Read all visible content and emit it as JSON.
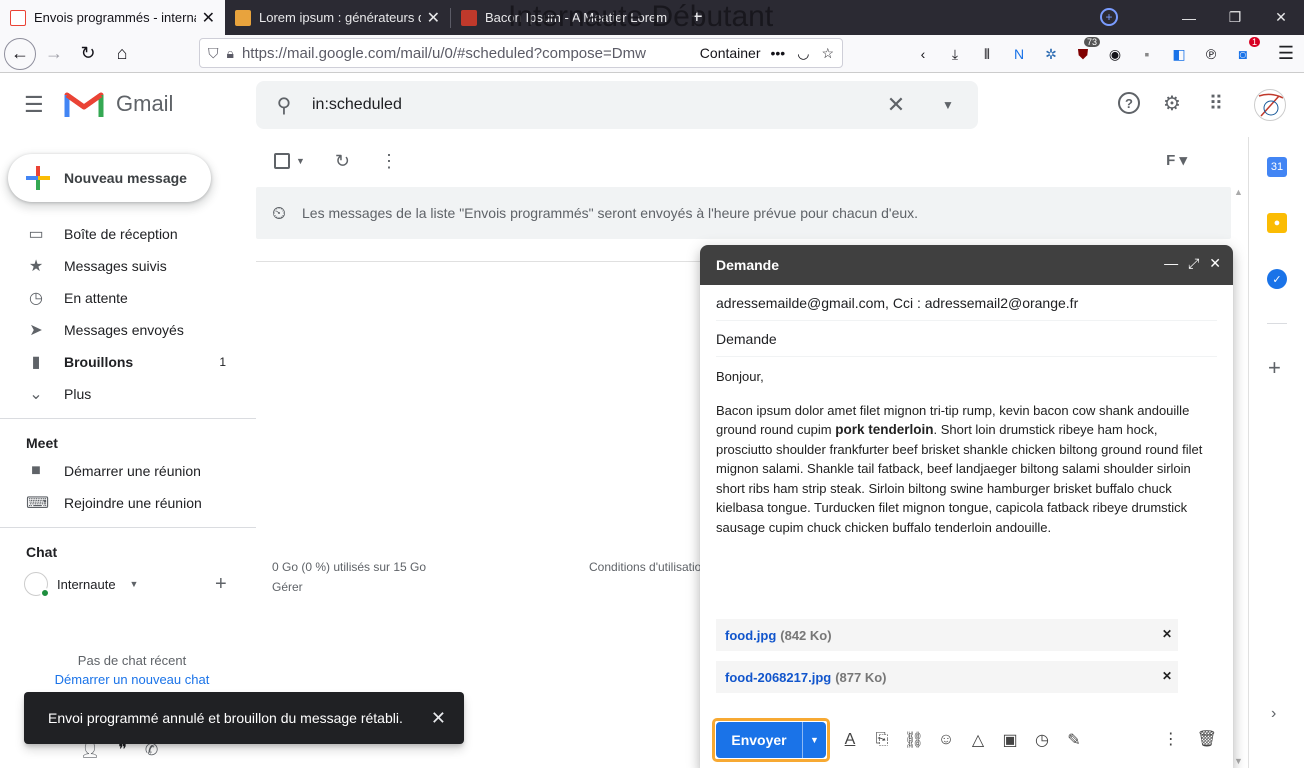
{
  "browser": {
    "tabs": [
      {
        "title": "Envois programmés - internaute",
        "active": true
      },
      {
        "title": "Lorem ipsum : générateurs de f",
        "active": false
      },
      {
        "title": "Bacon Ipsum - A Meatier Lorem",
        "active": false
      }
    ],
    "overlay_title": "Internaute Débutant",
    "url": "https://mail.google.com/mail/u/0/#scheduled?compose=Dmw",
    "url_domain": "mail.google.com",
    "container_label": "Container",
    "ext_badges": {
      "ublock": "73",
      "notif": "1"
    }
  },
  "gmail": {
    "app_name": "Gmail",
    "search_value": "in:scheduled",
    "compose_label": "Nouveau message",
    "nav": [
      {
        "icon": "inbox-icon",
        "glyph": "▭",
        "label": "Boîte de réception",
        "count": ""
      },
      {
        "icon": "star-icon",
        "glyph": "★",
        "label": "Messages suivis",
        "count": ""
      },
      {
        "icon": "clock-icon",
        "glyph": "◷",
        "label": "En attente",
        "count": ""
      },
      {
        "icon": "send-icon",
        "glyph": "➤",
        "label": "Messages envoyés",
        "count": ""
      },
      {
        "icon": "draft-icon",
        "glyph": "▮",
        "label": "Brouillons",
        "count": "1"
      },
      {
        "icon": "chevron-down-icon",
        "glyph": "⌄",
        "label": "Plus",
        "count": ""
      }
    ],
    "meet": {
      "title": "Meet",
      "items": [
        {
          "icon": "video-icon",
          "glyph": "■",
          "label": "Démarrer une réunion"
        },
        {
          "icon": "keyboard-icon",
          "glyph": "⌨",
          "label": "Rejoindre une réunion"
        }
      ]
    },
    "chat": {
      "title": "Chat",
      "user_name": "Internaute",
      "no_chat": "Pas de chat récent",
      "start_chat": "Démarrer un nouveau chat"
    },
    "banner": "Les messages de la liste \"Envois programmés\" seront envoyés à l'heure prévue pour chacun d'eux.",
    "storage": "0 Go (0 %) utilisés sur 15 Go",
    "manage": "Gérer",
    "terms": "Conditions d'utilisation",
    "view_toggle": "F"
  },
  "compose": {
    "title": "Demande",
    "recipients": "adressemailde@gmail.com, Cci : adressemail2@orange.fr",
    "subject": "Demande",
    "greeting": "Bonjour,",
    "body_before": "Bacon ipsum dolor amet filet mignon tri-tip rump, kevin bacon cow shank andouille ground round cupim ",
    "body_bold": "pork tenderloin",
    "body_after": ". Short loin drumstick ribeye ham hock, prosciutto shoulder frankfurter beef brisket shankle chicken biltong ground round filet mignon salami. Shankle tail fatback, beef landjaeger biltong salami shoulder sirloin short ribs ham strip steak. Sirloin biltong swine hamburger brisket buffalo chuck kielbasa tongue. Turducken filet mignon tongue, capicola fatback ribeye drumstick sausage cupim chuck chicken buffalo tenderloin andouille.",
    "attachments": [
      {
        "name": "food.jpg",
        "size": "(842 Ko)"
      },
      {
        "name": "food-2068217.jpg",
        "size": "(877 Ko)"
      }
    ],
    "send_label": "Envoyer"
  },
  "toast": {
    "message": "Envoi programmé annulé et brouillon du message rétabli."
  },
  "colors": {
    "accent": "#1a73e8",
    "send_highlight": "#f7a932",
    "compose_header": "#404040",
    "toast_bg": "#202124"
  }
}
